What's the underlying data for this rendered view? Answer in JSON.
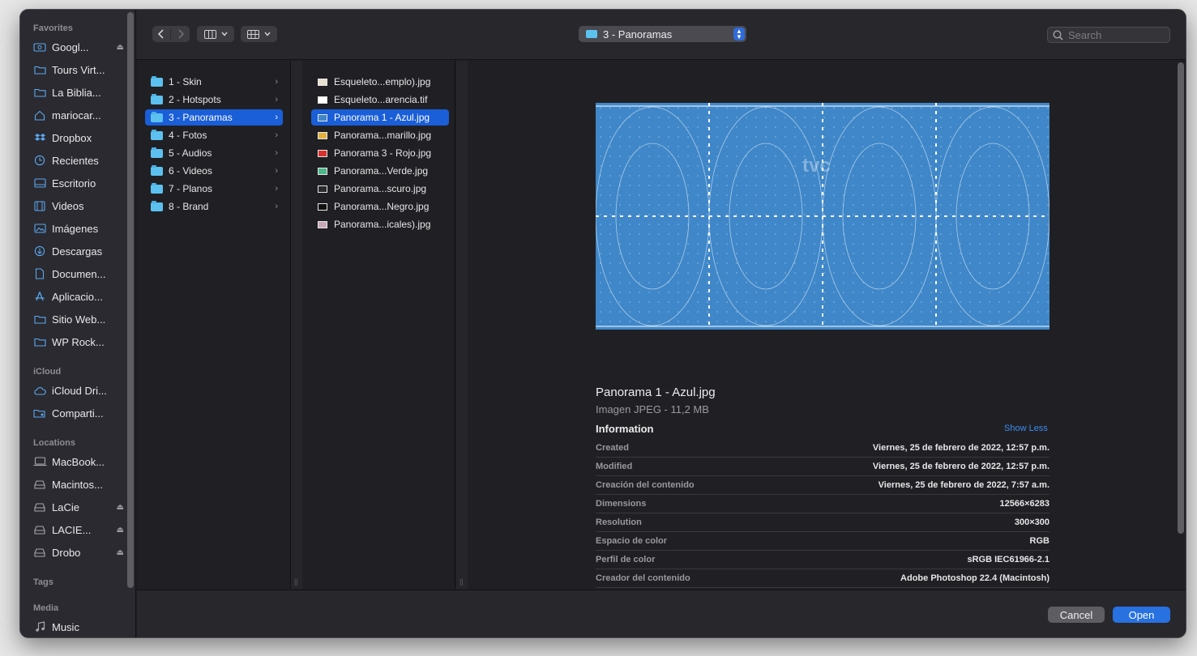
{
  "sidebar": {
    "sections": {
      "favorites": "Favorites",
      "icloud": "iCloud",
      "locations": "Locations",
      "tags": "Tags",
      "media": "Media"
    },
    "favorites": [
      {
        "label": "Googl...",
        "icon": "drive-icon",
        "eject": true
      },
      {
        "label": "Tours Virt...",
        "icon": "folder-icon"
      },
      {
        "label": "La Biblia...",
        "icon": "folder-icon"
      },
      {
        "label": "mariocar...",
        "icon": "home-icon"
      },
      {
        "label": "Dropbox",
        "icon": "dropbox-icon"
      },
      {
        "label": "Recientes",
        "icon": "clock-icon"
      },
      {
        "label": "Escritorio",
        "icon": "desktop-icon"
      },
      {
        "label": "Videos",
        "icon": "film-icon"
      },
      {
        "label": "Imágenes",
        "icon": "photo-icon"
      },
      {
        "label": "Descargas",
        "icon": "download-icon"
      },
      {
        "label": "Documen...",
        "icon": "document-icon"
      },
      {
        "label": "Aplicacio...",
        "icon": "apps-icon"
      },
      {
        "label": "Sitio Web...",
        "icon": "folder-icon"
      },
      {
        "label": "WP Rock...",
        "icon": "folder-icon"
      }
    ],
    "icloud": [
      {
        "label": "iCloud Dri...",
        "icon": "cloud-icon"
      },
      {
        "label": "Comparti...",
        "icon": "shared-folder-icon"
      }
    ],
    "locations": [
      {
        "label": "MacBook...",
        "icon": "laptop-icon"
      },
      {
        "label": "Macintos...",
        "icon": "disk-icon"
      },
      {
        "label": "LaCie",
        "icon": "disk-icon",
        "eject": true
      },
      {
        "label": "LACIE...",
        "icon": "disk-icon",
        "eject": true
      },
      {
        "label": "Drobo",
        "icon": "disk-icon",
        "eject": true
      }
    ],
    "media": [
      {
        "label": "Music",
        "icon": "music-icon"
      }
    ]
  },
  "toolbar": {
    "path": "3 - Panoramas",
    "search_placeholder": "Search"
  },
  "column1": [
    {
      "label": "1 - Skin"
    },
    {
      "label": "2 - Hotspots"
    },
    {
      "label": "3 - Panoramas",
      "selected": true
    },
    {
      "label": "4 - Fotos"
    },
    {
      "label": "5 - Audios"
    },
    {
      "label": "6 - Videos"
    },
    {
      "label": "7 - Planos"
    },
    {
      "label": "8 - Brand"
    }
  ],
  "column2": [
    {
      "label": "Esqueleto...emplo).jpg",
      "color": "#e8e0d0"
    },
    {
      "label": "Esqueleto...arencia.tif",
      "color": "#ffffff"
    },
    {
      "label": "Panorama 1 - Azul.jpg",
      "color": "#3f87c8",
      "selected": true
    },
    {
      "label": "Panorama...marillo.jpg",
      "color": "#e3b23c"
    },
    {
      "label": "Panorama 3 - Rojo.jpg",
      "color": "#d8322e"
    },
    {
      "label": "Panorama...Verde.jpg",
      "color": "#4cb58a"
    },
    {
      "label": "Panorama...scuro.jpg",
      "color": "#2a2a2a"
    },
    {
      "label": "Panorama...Negro.jpg",
      "color": "#111111"
    },
    {
      "label": "Panorama...icales).jpg",
      "color": "#c8a8b8"
    }
  ],
  "preview": {
    "filename": "Panorama 1 - Azul.jpg",
    "filetype": "Imagen JPEG - 11,2 MB",
    "info_title": "Information",
    "show_less": "Show Less",
    "watermark": "tvc",
    "info": [
      {
        "key": "Created",
        "value": "Viernes, 25 de febrero de 2022, 12:57 p.m."
      },
      {
        "key": "Modified",
        "value": "Viernes, 25 de febrero de 2022, 12:57 p.m."
      },
      {
        "key": "Creación del contenido",
        "value": "Viernes, 25 de febrero de 2022, 7:57 a.m."
      },
      {
        "key": "Dimensions",
        "value": "12566×6283"
      },
      {
        "key": "Resolution",
        "value": "300×300"
      },
      {
        "key": "Espacio de color",
        "value": "RGB"
      },
      {
        "key": "Perfil de color",
        "value": "sRGB IEC61966-2.1"
      },
      {
        "key": "Creador del contenido",
        "value": "Adobe Photoshop 22.4 (Macintosh)"
      }
    ]
  },
  "footer": {
    "cancel": "Cancel",
    "open": "Open"
  }
}
